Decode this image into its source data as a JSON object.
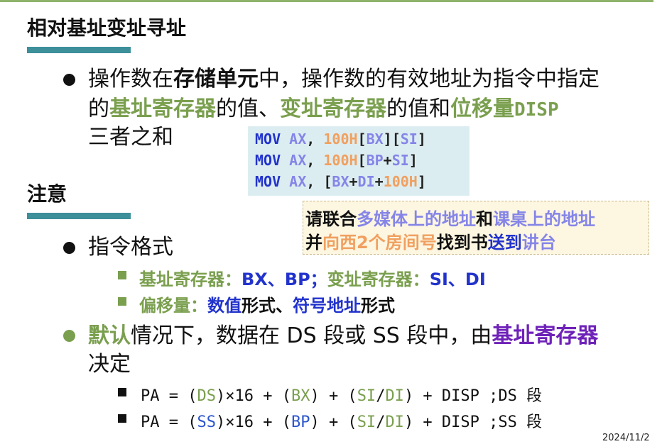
{
  "section1": {
    "title": "相对基址变址寻址",
    "bullet": {
      "l1_a": "操作数在",
      "l1_b": "存储单元",
      "l1_c": "中，操作数的有效地址为指令中指定",
      "l2_a": "的",
      "l2_b": "基址寄存器",
      "l2_c": "的值、",
      "l2_d": "变址寄存器",
      "l2_e": "的值和",
      "l2_f": "位移量",
      "l2_g": "DISP",
      "l3": "三者之和"
    }
  },
  "code": {
    "line1": {
      "op": "MOV",
      "reg": "AX",
      "comma": ",",
      "num": "100H",
      "b1": "[",
      "r1": "BX",
      "b2": "][",
      "r2": "SI",
      "b3": "]"
    },
    "line2": {
      "op": "MOV",
      "reg": "AX",
      "comma": ",",
      "num": "100H",
      "b1": "[",
      "r1": "BP",
      "plus": "+",
      "r2": "SI",
      "b3": "]"
    },
    "line3": {
      "op": "MOV",
      "reg": "AX",
      "comma": ",",
      "b1": "[",
      "r1": "BX",
      "plus1": "+",
      "r2": "DI",
      "plus2": "+",
      "num": "100H",
      "b3": "]"
    }
  },
  "note": {
    "l1_a": "请联合",
    "l1_b": "多媒体上的地址",
    "l1_c": "和",
    "l1_d": "课桌上的地址",
    "l2_a": "并",
    "l2_b": "向西2个房间号",
    "l2_c": "找到书",
    "l2_d": "送到",
    "l2_e": "讲台"
  },
  "section2": {
    "title": "注意",
    "bullet1": "指令格式",
    "sub1": {
      "a": "基址寄存器：",
      "b": "BX、BP；",
      "c": "变址寄存器：",
      "d": "SI、DI"
    },
    "sub2": {
      "a": "偏移量：",
      "b": "数值",
      "c": "形式、",
      "d": "符号地址",
      "e": "形式"
    },
    "bullet2": {
      "a": "默认",
      "b": "情况下，数据在 DS 段或 SS 段中，由",
      "c": "基址寄存器",
      "d": "决定"
    },
    "formula1": {
      "p1": "PA = (",
      "seg": "DS",
      "p2": ")×16 + (",
      "base": "BX",
      "p3": ") + (",
      "i1": "SI",
      "slash": "/",
      "i2": "DI",
      "p4": ") + DISP  ;DS 段"
    },
    "formula2": {
      "p1": "PA = (",
      "seg": "SS",
      "p2": ")×16 + (",
      "base": "BP",
      "p3": ") + (",
      "i1": "SI",
      "slash": "/",
      "i2": "DI",
      "p4": ") + DISP  ;SS 段"
    }
  },
  "footer": {
    "date": "2024/11/2"
  }
}
